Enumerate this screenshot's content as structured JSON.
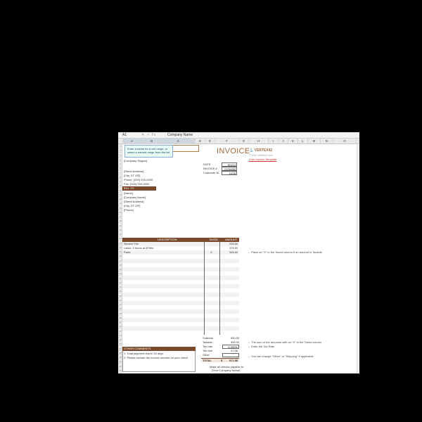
{
  "formula_bar": {
    "name_box": "A1",
    "icons": "✕ ✓ fx",
    "value": "Company Name"
  },
  "columns": [
    "A",
    "B",
    "C",
    "D",
    "E",
    "F",
    "G",
    "H",
    "I",
    "J",
    "K",
    "L",
    "M",
    "N",
    "O"
  ],
  "tooltip": "Enter a name for a cell range, or select a named range from the list",
  "company": {
    "slogan": "[Company Slogan]",
    "address": "[Street Address]",
    "city": "[City, ST ZIP]",
    "phone": "Phone: (000) 000-0000",
    "fax": "Fax: (000) 000-0000"
  },
  "invoice": {
    "title": "INVOICE",
    "date_label": "DATE",
    "date_value": "5/1/14",
    "invoice_label": "INVOICE #",
    "invoice_value": "[123456]",
    "customer_label": "Customer ID",
    "customer_value": "[123]"
  },
  "brand": {
    "logo": "VERTEX42",
    "logo_sub": "© 2014 Vertex42.com",
    "link": "Free Invoice Template"
  },
  "bill_to": {
    "header": "BILL TO",
    "lines": [
      "[Name]",
      "[Company Name]",
      "[Street Address]",
      "[City, ST ZIP]",
      "[Phone]"
    ]
  },
  "items": {
    "headers": [
      "DESCRIPTION",
      "TAXED",
      "AMOUNT"
    ],
    "rows": [
      {
        "description": "Service Fee",
        "taxed": "",
        "amount": "230.00"
      },
      {
        "description": "Labor: 5 hours at $75/hr",
        "taxed": "",
        "amount": "375.00"
      },
      {
        "description": "Parts",
        "taxed": "X",
        "amount": "345.00"
      }
    ]
  },
  "totals": {
    "rows": [
      {
        "label": "Subtotal",
        "value": "950.00"
      },
      {
        "label": "Taxable",
        "value": "345.00"
      },
      {
        "label": "Tax rate",
        "value": "6.250%"
      },
      {
        "label": "Tax due",
        "value": "21.56"
      },
      {
        "label": "Other",
        "value": "-"
      }
    ],
    "total_label": "TOTAL",
    "currency": "$",
    "total_value": "971.56"
  },
  "comments": {
    "header": "OTHER COMMENTS",
    "lines": [
      "1. Total payment due in 30 days",
      "2. Please include the invoice number on your check"
    ]
  },
  "payable": [
    "Make all checks payable to",
    "[Your Company Name]"
  ],
  "notes": [
    "← Place an \"X\" in the Taxed column if an amount is Taxable",
    "← The sum of the amounts with an \"X\" in the Taxed column",
    "← Enter the Tax Rate",
    "← You can change \"Other\" to \"Shipping\" if applicable"
  ],
  "colors": {
    "background": "#000000",
    "brown_header": "#7a4a2e",
    "title_brown": "#a26a3e",
    "link_red": "#c0392b"
  }
}
